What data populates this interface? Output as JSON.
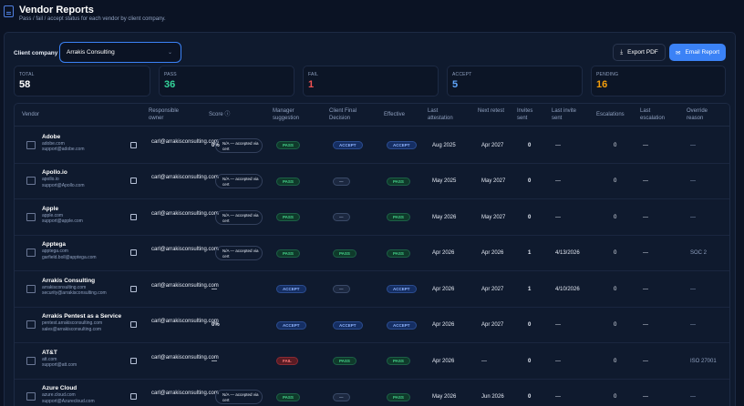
{
  "header": {
    "title": "Vendor Reports",
    "subtitle": "Pass / fail / accept status for each vendor by client company."
  },
  "toolbar": {
    "client_label": "Client company",
    "client_value": "Arrakis Consulting",
    "export_label": "Export PDF",
    "email_label": "Email Report"
  },
  "stats": [
    {
      "label": "TOTAL",
      "value": "58",
      "color": "#ffffff"
    },
    {
      "label": "PASS",
      "value": "36",
      "color": "#34d399"
    },
    {
      "label": "FAIL",
      "value": "1",
      "color": "#f05252"
    },
    {
      "label": "ACCEPT",
      "value": "5",
      "color": "#60a5fa"
    },
    {
      "label": "PENDING",
      "value": "16",
      "color": "#f59e0b"
    }
  ],
  "columns": [
    "Vendor",
    "Responsible owner",
    "Score",
    "Manager suggestion",
    "Client Final Decision",
    "Effective",
    "Last attestation",
    "Next retest",
    "Invites sent",
    "Last invite sent",
    "Escalations",
    "Last escalation",
    "Override reason"
  ],
  "rows": [
    {
      "name": "Adobe",
      "domain": "adobe.com",
      "email": "support@adobe.com",
      "owner": "carl@arrakisconsulting.com",
      "score": "0%",
      "na": "N/A — accepted via cert",
      "mgr": "PASS",
      "client": "ACCEPT",
      "eff": "ACCEPT",
      "last": "Aug 2025",
      "next": "Apr 2027",
      "inv": "0",
      "lastinv": "—",
      "esc": "0",
      "lastesc": "—",
      "override": "—"
    },
    {
      "name": "Apollo.io",
      "domain": "apollo.io",
      "email": "support@Apollo.com",
      "owner": "carl@arrakisconsulting.com",
      "score": "",
      "na": "N/A — accepted via cert",
      "mgr": "PASS",
      "client": "—",
      "eff": "PASS",
      "last": "May 2025",
      "next": "May 2027",
      "inv": "0",
      "lastinv": "—",
      "esc": "0",
      "lastesc": "—",
      "override": "—"
    },
    {
      "name": "Apple",
      "domain": "apple.com",
      "email": "support@apple.com",
      "owner": "carl@arrakisconsulting.com",
      "score": "",
      "na": "N/A — accepted via cert",
      "mgr": "PASS",
      "client": "—",
      "eff": "PASS",
      "last": "May 2026",
      "next": "May 2027",
      "inv": "0",
      "lastinv": "—",
      "esc": "0",
      "lastesc": "—",
      "override": "—"
    },
    {
      "name": "Apptega",
      "domain": "apptega.com",
      "email": "garfield.boll@apptega.com",
      "owner": "carl@arrakisconsulting.com",
      "score": "",
      "na": "N/A — accepted via cert",
      "mgr": "PASS",
      "client": "PASS",
      "eff": "PASS",
      "last": "Apr 2026",
      "next": "Apr 2026",
      "inv": "1",
      "lastinv": "4/13/2026",
      "esc": "0",
      "lastesc": "—",
      "override": "SOC 2"
    },
    {
      "name": "Arrakis Consulting",
      "domain": "arrakisconsulting.com",
      "email": "security@arrakisconsulting.com",
      "owner": "carl@arrakisconsulting.com",
      "score": "—",
      "na": "",
      "mgr": "ACCEPT",
      "client": "—",
      "eff": "ACCEPT",
      "last": "Apr 2026",
      "next": "Apr 2027",
      "inv": "1",
      "lastinv": "4/10/2026",
      "esc": "0",
      "lastesc": "—",
      "override": "—"
    },
    {
      "name": "Arrakis Pentest as a Service",
      "domain": "pentest.arrakisconsulting.com",
      "email": "sales@arrakisconsulting.com",
      "owner": "carl@arrakisconsulting.com",
      "score": "0%",
      "na": "",
      "mgr": "ACCEPT",
      "client": "ACCEPT",
      "eff": "ACCEPT",
      "last": "Apr 2026",
      "next": "Apr 2027",
      "inv": "0",
      "lastinv": "—",
      "esc": "0",
      "lastesc": "—",
      "override": "—"
    },
    {
      "name": "AT&T",
      "domain": "att.com",
      "email": "support@att.com",
      "owner": "carl@arrakisconsulting.com",
      "score": "—",
      "na": "",
      "mgr": "FAIL",
      "client": "PASS",
      "eff": "PASS",
      "last": "Apr 2026",
      "next": "—",
      "inv": "0",
      "lastinv": "—",
      "esc": "0",
      "lastesc": "—",
      "override": "ISO 27001"
    },
    {
      "name": "Azure Cloud",
      "domain": "azure.cloud.com",
      "email": "support@Azurecloud.com",
      "owner": "carl@arrakisconsulting.com",
      "score": "",
      "na": "N/A — accepted via cert",
      "mgr": "PASS",
      "client": "—",
      "eff": "PASS",
      "last": "May 2026",
      "next": "Jun 2026",
      "inv": "0",
      "lastinv": "—",
      "esc": "0",
      "lastesc": "—",
      "override": "—"
    }
  ]
}
